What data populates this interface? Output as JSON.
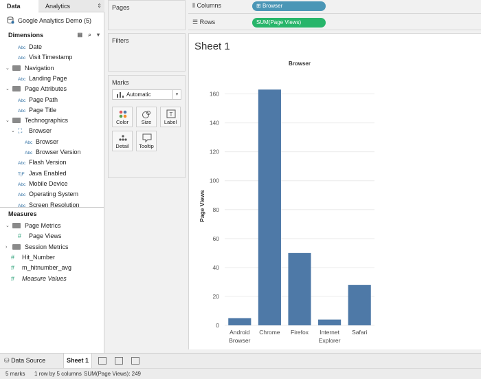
{
  "tabs": {
    "data": "Data",
    "analytics": "Analytics"
  },
  "datasource": {
    "name": "Google Analytics Demo (5)"
  },
  "dimensions": {
    "title": "Dimensions",
    "items": [
      {
        "type": "Abc",
        "label": "Date"
      },
      {
        "type": "Abc",
        "label": "Visit Timestamp"
      },
      {
        "folder": true,
        "label": "Navigation"
      },
      {
        "type": "Abc",
        "label": "Landing Page"
      },
      {
        "folder": true,
        "label": "Page Attributes"
      },
      {
        "type": "Abc",
        "label": "Page Path"
      },
      {
        "type": "Abc",
        "label": "Page Title"
      },
      {
        "folder": true,
        "label": "Technographics"
      },
      {
        "hier": true,
        "label": "Browser"
      },
      {
        "type": "Abc",
        "label": "Browser"
      },
      {
        "type": "Abc",
        "label": "Browser Version"
      },
      {
        "type": "Abc",
        "label": "Flash Version"
      },
      {
        "type": "T|F",
        "label": "Java Enabled"
      },
      {
        "type": "Abc",
        "label": "Mobile Device"
      },
      {
        "type": "Abc",
        "label": "Operating System"
      },
      {
        "type": "Abc",
        "label": "Screen Resolution"
      }
    ]
  },
  "measures": {
    "title": "Measures",
    "items": [
      {
        "folder": true,
        "label": "Page Metrics"
      },
      {
        "type": "#",
        "label": "Page Views"
      },
      {
        "folder": true,
        "label": "Session Metrics"
      },
      {
        "type": "#",
        "label": "Hit_Number"
      },
      {
        "type": "#",
        "label": "m_hitnumber_avg"
      },
      {
        "type": "#",
        "label": "Measure Values"
      }
    ]
  },
  "cards": {
    "pages": "Pages",
    "filters": "Filters",
    "marks": "Marks"
  },
  "marks": {
    "type": "Automatic",
    "buttons": {
      "color": "Color",
      "size": "Size",
      "label": "Label",
      "detail": "Detail",
      "tooltip": "Tooltip"
    }
  },
  "shelves": {
    "columns_label": "Columns",
    "columns_pill": "Browser",
    "rows_label": "Rows",
    "rows_pill": "SUM(Page Views)"
  },
  "sheet": {
    "title": "Sheet 1"
  },
  "chart_data": {
    "type": "bar",
    "title": "Browser",
    "xlabel": "",
    "ylabel": "Page Views",
    "categories": [
      "Android Browser",
      "Chrome",
      "Firefox",
      "Internet Explorer",
      "Safari"
    ],
    "category_lines": [
      [
        "Android",
        "Browser"
      ],
      [
        "Chrome"
      ],
      [
        "Firefox"
      ],
      [
        "Internet",
        "Explorer"
      ],
      [
        "Safari"
      ]
    ],
    "values": [
      5,
      163,
      50,
      4,
      28
    ],
    "yticks": [
      0,
      20,
      40,
      60,
      80,
      100,
      120,
      140,
      160
    ],
    "ylim": [
      0,
      165
    ],
    "grid": true,
    "bar_color": "#4e79a7"
  },
  "bottom_tabs": {
    "datasource": "Data Source",
    "sheet": "Sheet 1"
  },
  "status": {
    "marks": "5 marks",
    "dims": "1 row by 5 columns",
    "sum": "SUM(Page Views): 249"
  }
}
